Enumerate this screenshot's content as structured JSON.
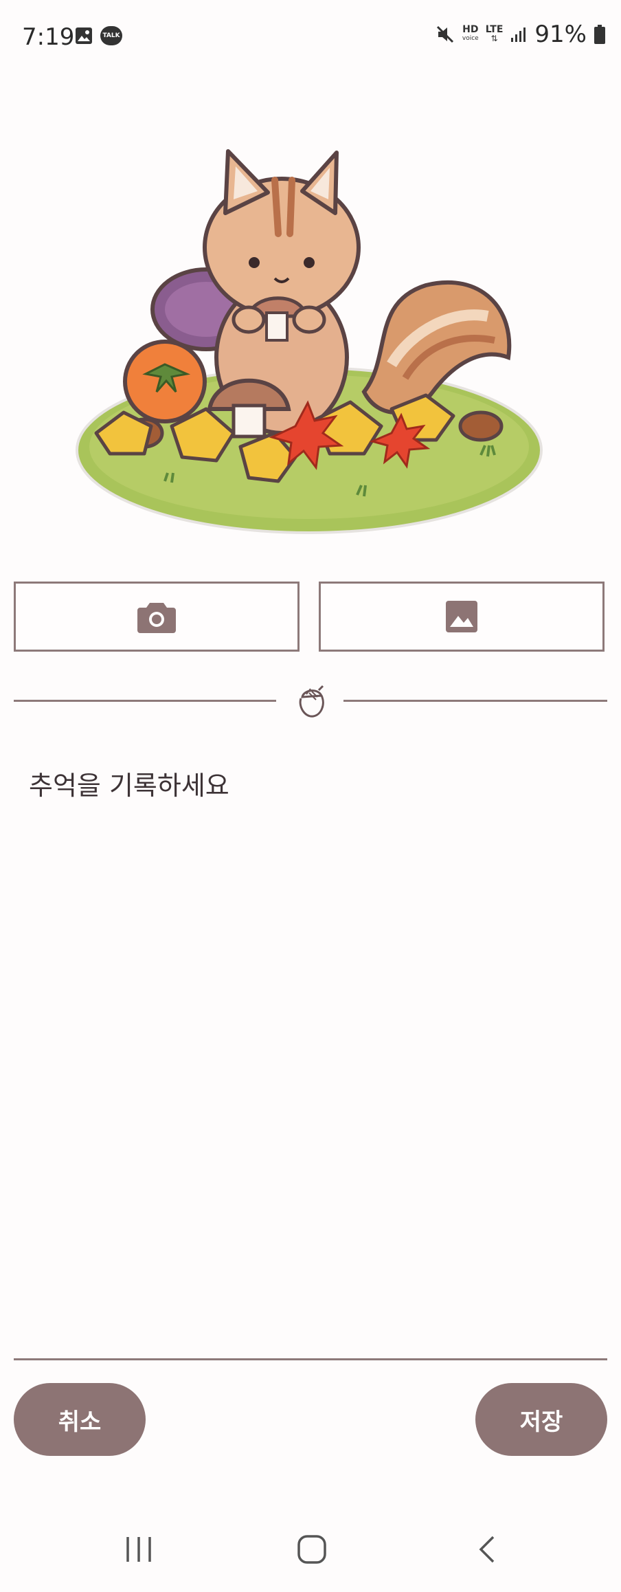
{
  "status_bar": {
    "time": "7:19",
    "battery": "91%",
    "network_labels": {
      "hd_top": "HD",
      "hd_bottom": "voice",
      "lte": "LTE"
    },
    "talk_label": "TALK",
    "icons": [
      "image-notification-icon",
      "kakaotalk-icon",
      "mute-icon",
      "signal-icon",
      "battery-icon"
    ]
  },
  "media_buttons": {
    "camera_icon": "camera-icon",
    "gallery_icon": "gallery-icon"
  },
  "divider": {
    "icon": "acorn-icon"
  },
  "memo": {
    "placeholder": "추억을 기록하세요"
  },
  "actions": {
    "cancel_label": "취소",
    "save_label": "저장"
  },
  "colors": {
    "accent": "#8d7474",
    "line": "#8d7979",
    "background": "#fefcfc"
  },
  "nav": {
    "icons": [
      "recent-apps-icon",
      "home-icon",
      "back-icon"
    ]
  }
}
